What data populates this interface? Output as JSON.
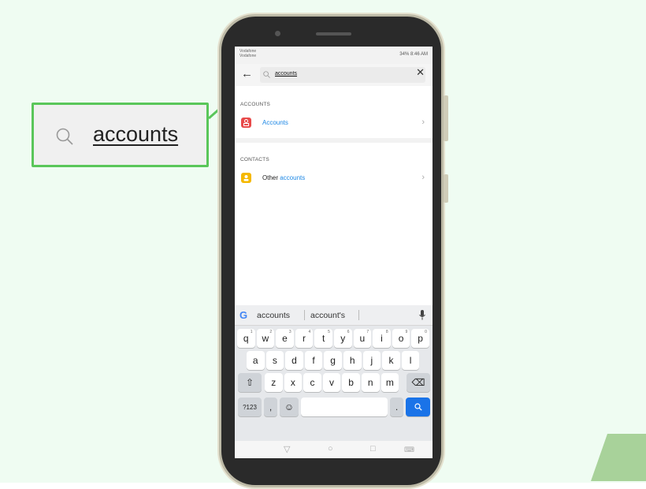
{
  "callout": {
    "text": "accounts"
  },
  "phone": {
    "status": {
      "carrier_line1": "Vodafone",
      "carrier_line2": "Vodafone",
      "sys": "34% 8:46 AM"
    },
    "search": {
      "query": "accounts"
    },
    "sections": [
      {
        "header": "ACCOUNTS",
        "result_label": "Accounts",
        "icon_color": "#e84a4a"
      },
      {
        "header": "CONTACTS",
        "result_prefix": "Other ",
        "result_highlight": "accounts",
        "icon_color": "#f5b800"
      }
    ],
    "keyboard": {
      "suggestions": [
        "accounts",
        "account's"
      ],
      "row1": [
        {
          "k": "q",
          "n": "1"
        },
        {
          "k": "w",
          "n": "2"
        },
        {
          "k": "e",
          "n": "3"
        },
        {
          "k": "r",
          "n": "4"
        },
        {
          "k": "t",
          "n": "5"
        },
        {
          "k": "y",
          "n": "6"
        },
        {
          "k": "u",
          "n": "7"
        },
        {
          "k": "i",
          "n": "8"
        },
        {
          "k": "o",
          "n": "9"
        },
        {
          "k": "p",
          "n": "0"
        }
      ],
      "row2": [
        "a",
        "s",
        "d",
        "f",
        "g",
        "h",
        "j",
        "k",
        "l"
      ],
      "row3": [
        "z",
        "x",
        "c",
        "v",
        "b",
        "n",
        "m"
      ],
      "symbols_label": "?123",
      "comma_label": ",",
      "period_label": "."
    },
    "colors": {
      "accent": "#1a73e8",
      "link": "#1e88e5",
      "callout_border": "#5ac65a"
    }
  }
}
